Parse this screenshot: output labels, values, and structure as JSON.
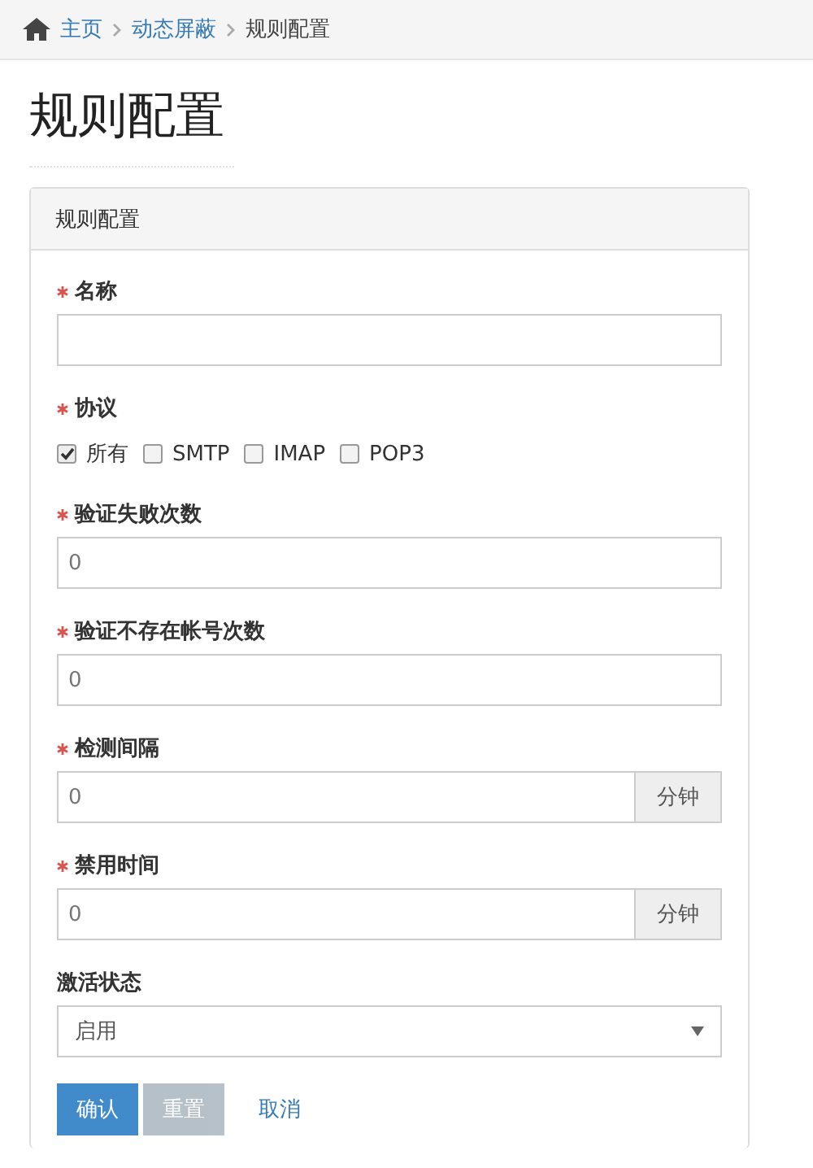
{
  "breadcrumb": [
    {
      "label": "主页",
      "link": true
    },
    {
      "label": "动态屏蔽",
      "link": true
    },
    {
      "label": "规则配置",
      "link": false
    }
  ],
  "page_title": "规则配置",
  "panel": {
    "title": "规则配置",
    "fields": [
      {
        "kind": "text",
        "label": "名称",
        "required": true
      },
      {
        "kind": "checkboxes",
        "label": "协议",
        "required": true,
        "options": [
          {
            "label": "所有",
            "checked": true
          },
          {
            "label": "SMTP",
            "checked": false
          },
          {
            "label": "IMAP",
            "checked": false
          },
          {
            "label": "POP3",
            "checked": false
          }
        ]
      },
      {
        "kind": "text",
        "label": "验证失败次数",
        "required": true,
        "value": "0"
      },
      {
        "kind": "text",
        "label": "验证不存在帐号次数",
        "required": true,
        "value": "0"
      },
      {
        "kind": "addon",
        "label": "检测间隔",
        "required": true,
        "value": "0",
        "addon": "分钟"
      },
      {
        "kind": "addon",
        "label": "禁用时间",
        "required": true,
        "value": "0",
        "addon": "分钟"
      },
      {
        "kind": "select",
        "label": "激活状态",
        "required": false,
        "value": "启用"
      }
    ],
    "buttons": [
      {
        "label": "确认",
        "kind": "primary",
        "disabled": false
      },
      {
        "label": "重置",
        "kind": "default",
        "disabled": true
      },
      {
        "label": "取消",
        "kind": "link",
        "disabled": false
      }
    ]
  }
}
